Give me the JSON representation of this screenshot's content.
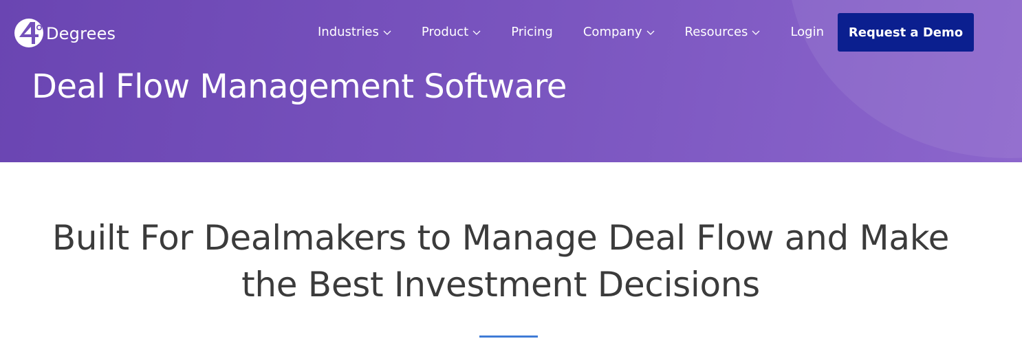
{
  "brand": {
    "logo_mark_digit": "4",
    "name": "Degrees"
  },
  "nav": {
    "items": [
      {
        "label": "Industries",
        "has_dropdown": true
      },
      {
        "label": "Product",
        "has_dropdown": true
      },
      {
        "label": "Pricing",
        "has_dropdown": false
      },
      {
        "label": "Company",
        "has_dropdown": true
      },
      {
        "label": "Resources",
        "has_dropdown": true
      },
      {
        "label": "Login",
        "has_dropdown": false
      }
    ],
    "cta_label": "Request a Demo"
  },
  "hero": {
    "title": "Deal Flow Management Software"
  },
  "main": {
    "headline_line1": "Built For Dealmakers to Manage Deal Flow and Make",
    "headline_line2": "the Best Investment Decisions"
  },
  "colors": {
    "hero_gradient_start": "#6a45b2",
    "hero_gradient_end": "#8c66cc",
    "cta_background": "#0b1f8f",
    "headline_text": "#3b3b3b",
    "divider": "#3f7bd6"
  }
}
